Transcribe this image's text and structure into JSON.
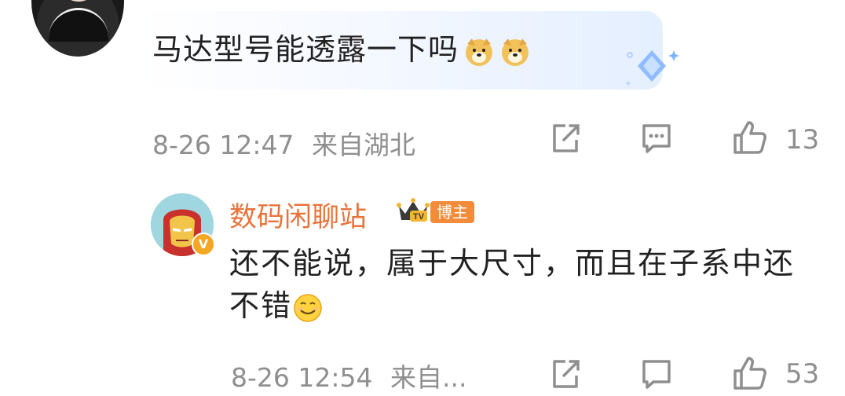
{
  "comment": {
    "text": "马达型号能透露一下吗",
    "emojis": [
      "doge-emoji",
      "doge-emoji"
    ],
    "date": "8-26 12:47",
    "location": "来自湖北",
    "like_count": "13"
  },
  "reply": {
    "author": "数码闲聊站",
    "tag": "博主",
    "crown_label": "TV",
    "text": "还不能说，属于大尺寸，而且在子系中还不错",
    "date": "8-26 12:54",
    "location": "来自...",
    "like_count": "53",
    "emoji": "smile-emoji"
  },
  "colors": {
    "name": "#e8743b",
    "meta": "#8f8f8f",
    "text": "#222222",
    "tag": "#f28c3a"
  }
}
